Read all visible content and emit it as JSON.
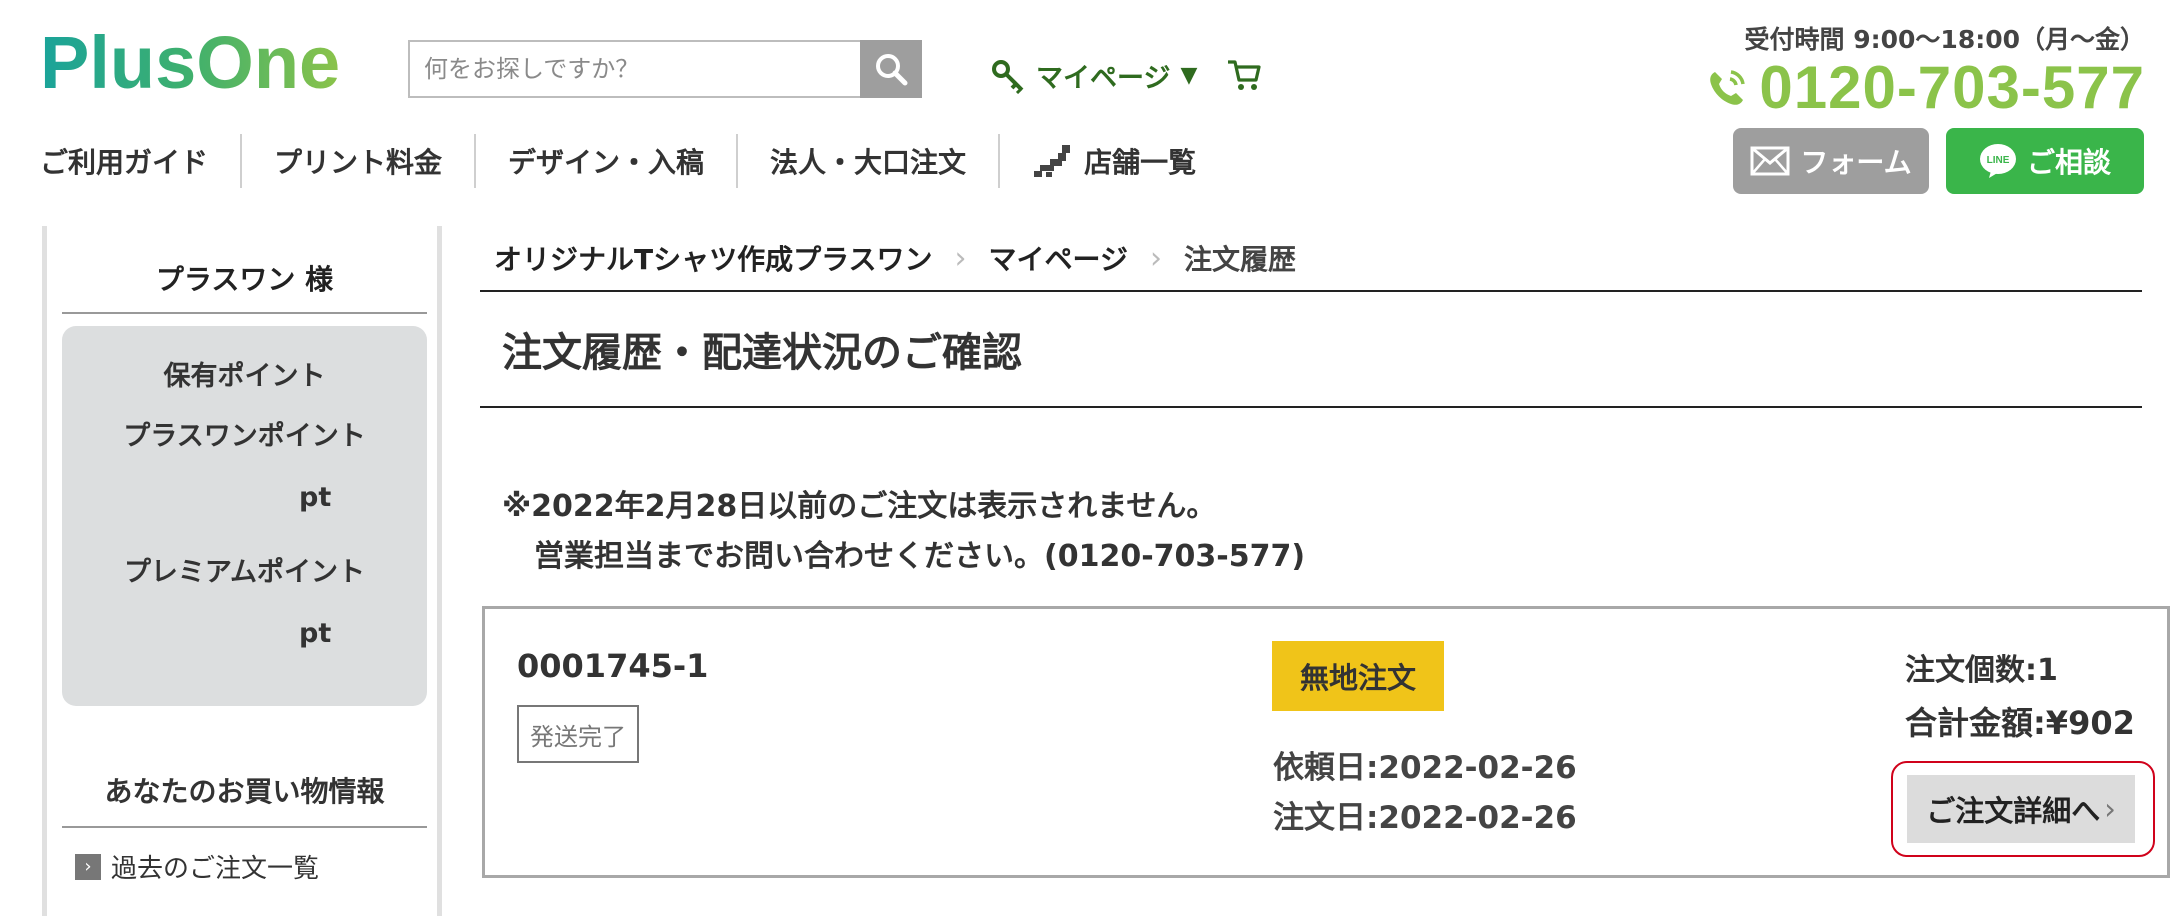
{
  "header": {
    "brand": "PlusOne",
    "search": {
      "placeholder": "何をお探しですか？"
    },
    "mypage_label": "マイページ",
    "mypage_caret": "▼",
    "hours": "受付時間 9:00〜18:00（月〜金）",
    "phone": "0120-703-577",
    "form_label": "フォーム",
    "line_icon_text": "LINE",
    "line_label": "ご相談"
  },
  "nav": [
    {
      "label": "ご利用ガイド"
    },
    {
      "label": "プリント料金"
    },
    {
      "label": "デザイン・入稿"
    },
    {
      "label": "法人・大口注文"
    },
    {
      "label": "店舗一覧"
    }
  ],
  "sidebar": {
    "user": "プラスワン 様",
    "points_title": "保有ポイント",
    "plusone_points_label": "プラスワンポイント",
    "plusone_points_unit": "pt",
    "premium_points_label": "プレミアムポイント",
    "premium_points_unit": "pt",
    "shopping_title": "あなたのお買い物情報",
    "past_orders_link": "過去のご注文一覧"
  },
  "breadcrumb": [
    "オリジナルTシャツ作成プラスワン",
    "マイページ",
    "注文履歴"
  ],
  "breadcrumb_sep": "›",
  "page_title": "注文履歴・配達状況のご確認",
  "notice": {
    "line1": "※2022年2月28日以前のご注文は表示されません。",
    "line2": "営業担当までお問い合わせください。(0120-703-577)"
  },
  "order": {
    "number": "0001745-1",
    "status": "発送完了",
    "type": "無地注文",
    "request_date": "依頼日:2022-02-26",
    "order_date": "注文日:2022-02-26",
    "quantity": "注文個数:1",
    "total": "合計金額:¥902",
    "detail_button": "ご注文詳細へ",
    "detail_arrow": "›"
  },
  "colors": {
    "brand_green": "#8bc34a",
    "brand_teal": "#1aa39a",
    "line_green": "#3ab54a",
    "badge_yellow": "#f0c419",
    "highlight_red": "#d0021b"
  }
}
